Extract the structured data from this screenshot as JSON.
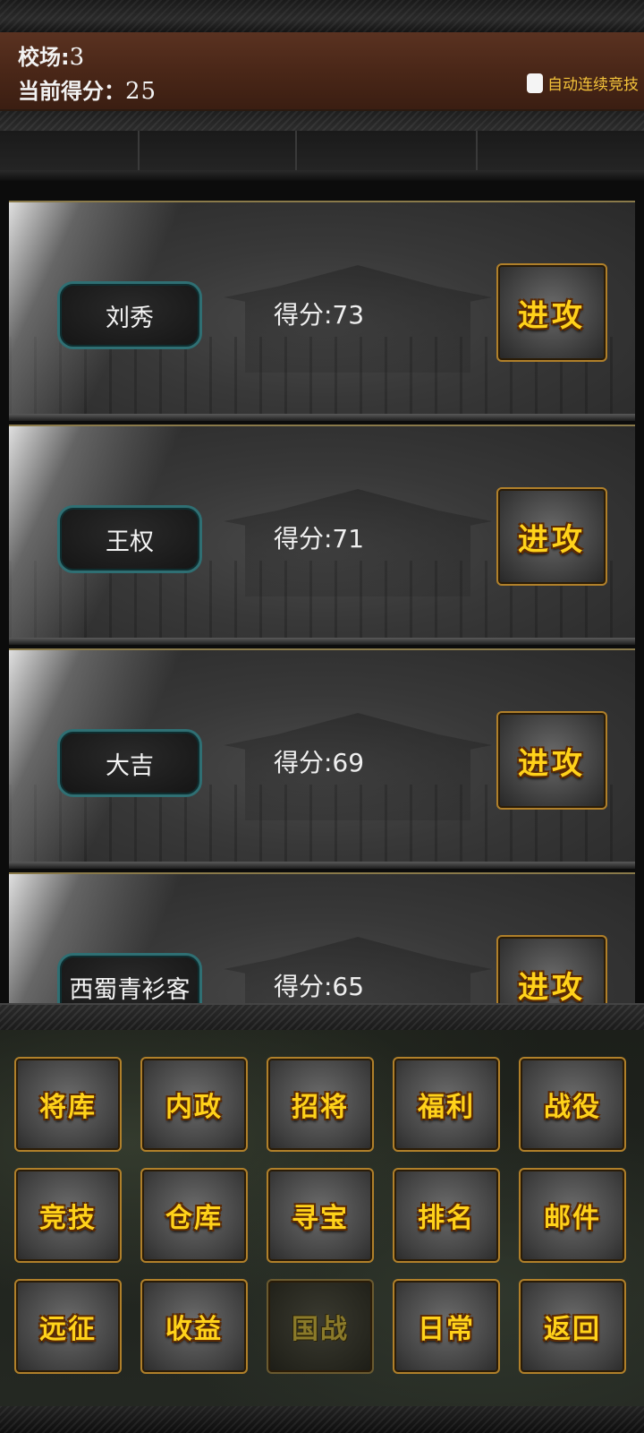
{
  "header": {
    "arena_label": "校场:",
    "arena_value": "3",
    "score_label": "当前得分：",
    "score_value": "25",
    "auto_compete_label": "自动连续竞技"
  },
  "opponents": [
    {
      "name": "刘秀",
      "score": "得分:73",
      "action": "进攻"
    },
    {
      "name": "王权",
      "score": "得分:71",
      "action": "进攻"
    },
    {
      "name": "大吉",
      "score": "得分:69",
      "action": "进攻"
    },
    {
      "name": "西蜀青衫客",
      "score": "得分:65",
      "action": "进攻"
    }
  ],
  "menu": {
    "rows": [
      [
        "将库",
        "内政",
        "招将",
        "福利",
        "战役"
      ],
      [
        "竞技",
        "仓库",
        "寻宝",
        "排名",
        "邮件"
      ],
      [
        "远征",
        "收益",
        "国战",
        "日常",
        "返回"
      ]
    ],
    "disabled": [
      "国战"
    ]
  },
  "colors": {
    "accent_gold": "#ffd21a",
    "header_brown": "#4a2718",
    "pill_border": "#2f6f73"
  }
}
